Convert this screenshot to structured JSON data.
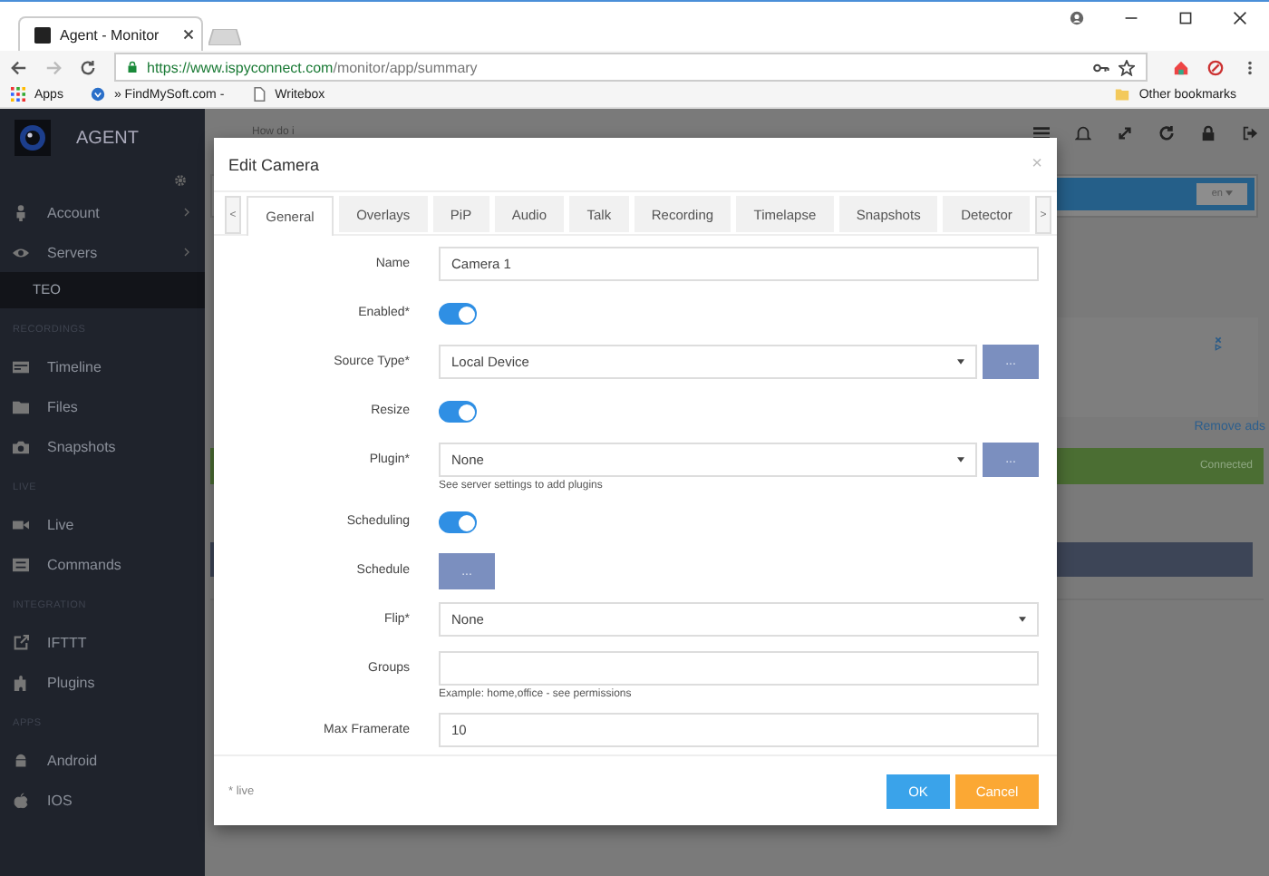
{
  "browser": {
    "tab_title": "Agent - Monitor",
    "url_host": "https://www.ispyconnect.com",
    "url_path": "/monitor/app/summary",
    "bookmarks": [
      "Apps",
      "» FindMySoft.com -",
      "Writebox"
    ],
    "other_bookmarks": "Other bookmarks"
  },
  "sidebar": {
    "brand": "AGENT",
    "items": [
      {
        "kind": "item",
        "label": "Account",
        "arrow": true
      },
      {
        "kind": "item",
        "label": "Servers",
        "arrow": true
      },
      {
        "kind": "sub",
        "label": "TEO",
        "selected": true
      },
      {
        "kind": "section",
        "label": "RECORDINGS"
      },
      {
        "kind": "item",
        "label": "Timeline",
        "arrow": false
      },
      {
        "kind": "item",
        "label": "Files",
        "arrow": false
      },
      {
        "kind": "item",
        "label": "Snapshots",
        "arrow": false
      },
      {
        "kind": "section",
        "label": "LIVE"
      },
      {
        "kind": "item",
        "label": "Live",
        "arrow": false
      },
      {
        "kind": "item",
        "label": "Commands",
        "arrow": false
      },
      {
        "kind": "section",
        "label": "INTEGRATION"
      },
      {
        "kind": "item",
        "label": "IFTTT",
        "arrow": false
      },
      {
        "kind": "item",
        "label": "Plugins",
        "arrow": false
      },
      {
        "kind": "section",
        "label": "APPS"
      },
      {
        "kind": "item",
        "label": "Android",
        "arrow": false
      },
      {
        "kind": "item",
        "label": "IOS",
        "arrow": false
      }
    ]
  },
  "main": {
    "search_text": "How do i",
    "language": "en",
    "remove_ads": "Remove ads",
    "status": "Connected"
  },
  "modal": {
    "title": "Edit Camera",
    "close": "×",
    "prev": "<",
    "next": ">",
    "tabs": [
      {
        "label": "General",
        "selected": true
      },
      {
        "label": "Overlays",
        "selected": false
      },
      {
        "label": "PiP",
        "selected": false
      },
      {
        "label": "Audio",
        "selected": false
      },
      {
        "label": "Talk",
        "selected": false
      },
      {
        "label": "Recording",
        "selected": false
      },
      {
        "label": "Timelapse",
        "selected": false
      },
      {
        "label": "Snapshots",
        "selected": false
      },
      {
        "label": "Detector",
        "selected": false
      }
    ],
    "fields": [
      {
        "kind": "text",
        "label": "Name",
        "value": "Camera 1"
      },
      {
        "kind": "toggle",
        "label": "Enabled*",
        "on": true
      },
      {
        "kind": "select-button",
        "label": "Source Type*",
        "value": "Local Device",
        "button": "..."
      },
      {
        "kind": "toggle",
        "label": "Resize",
        "on": true
      },
      {
        "kind": "select-button",
        "label": "Plugin*",
        "value": "None",
        "button": "...",
        "help": "See server settings to add plugins"
      },
      {
        "kind": "toggle",
        "label": "Scheduling",
        "on": true
      },
      {
        "kind": "button",
        "label": "Schedule",
        "button": "..."
      },
      {
        "kind": "select",
        "label": "Flip*",
        "value": "None"
      },
      {
        "kind": "text",
        "label": "Groups",
        "help": "Example: home,office - see permissions"
      },
      {
        "kind": "text",
        "label": "Max Framerate",
        "value": "10"
      }
    ],
    "footer_note": "* live",
    "buttons": [
      {
        "kind": "primary",
        "label": "OK"
      },
      {
        "kind": "warning",
        "label": "Cancel"
      }
    ]
  }
}
